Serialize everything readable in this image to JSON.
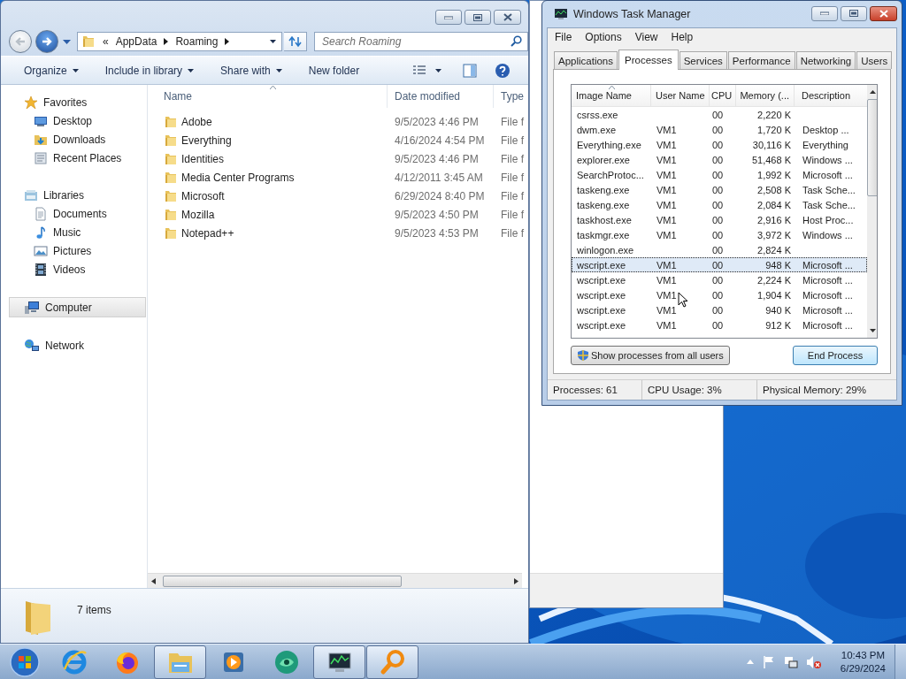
{
  "explorer": {
    "address": {
      "overflow_mark": "«",
      "path": [
        "AppData",
        "Roaming"
      ]
    },
    "search": {
      "placeholder": "Search Roaming"
    },
    "toolbar": [
      {
        "label": "Organize",
        "menu": true
      },
      {
        "label": "Include in library",
        "menu": true
      },
      {
        "label": "Share with",
        "menu": true
      },
      {
        "label": "New folder",
        "menu": false
      }
    ],
    "nav": [
      {
        "label": "Favorites",
        "kind": "favorites",
        "selected": false,
        "children": [
          {
            "label": "Desktop",
            "kind": "desktop",
            "selected": false
          },
          {
            "label": "Downloads",
            "kind": "downloads",
            "selected": false
          },
          {
            "label": "Recent Places",
            "kind": "recent",
            "selected": false
          }
        ]
      },
      {
        "label": "Libraries",
        "kind": "libraries",
        "selected": false,
        "children": [
          {
            "label": "Documents",
            "kind": "documents",
            "selected": false
          },
          {
            "label": "Music",
            "kind": "music",
            "selected": false
          },
          {
            "label": "Pictures",
            "kind": "pictures",
            "selected": false
          },
          {
            "label": "Videos",
            "kind": "videos",
            "selected": false
          }
        ]
      },
      {
        "label": "Computer",
        "kind": "computer",
        "selected": true
      },
      {
        "label": "Network",
        "kind": "network",
        "selected": false
      }
    ],
    "columns": [
      "Name",
      "Date modified",
      "Type"
    ],
    "files": [
      {
        "name": "Adobe",
        "date": "9/5/2023 4:46 PM",
        "type": "File f"
      },
      {
        "name": "Everything",
        "date": "4/16/2024 4:54 PM",
        "type": "File f"
      },
      {
        "name": "Identities",
        "date": "9/5/2023 4:46 PM",
        "type": "File f"
      },
      {
        "name": "Media Center Programs",
        "date": "4/12/2011 3:45 AM",
        "type": "File f"
      },
      {
        "name": "Microsoft",
        "date": "6/29/2024 8:40 PM",
        "type": "File f"
      },
      {
        "name": "Mozilla",
        "date": "9/5/2023 4:50 PM",
        "type": "File f"
      },
      {
        "name": "Notepad++",
        "date": "9/5/2023 4:53 PM",
        "type": "File f"
      }
    ],
    "status": "7 items"
  },
  "task_manager": {
    "title": "Windows Task Manager",
    "menu": [
      "File",
      "Options",
      "View",
      "Help"
    ],
    "tabs": [
      {
        "label": "Applications",
        "selected": false
      },
      {
        "label": "Processes",
        "selected": true
      },
      {
        "label": "Services",
        "selected": false
      },
      {
        "label": "Performance",
        "selected": false
      },
      {
        "label": "Networking",
        "selected": false
      },
      {
        "label": "Users",
        "selected": false
      }
    ],
    "columns": [
      "Image Name",
      "User Name",
      "CPU",
      "Memory (...",
      "Description"
    ],
    "rows": [
      {
        "image": "csrss.exe",
        "user": "",
        "cpu": "00",
        "memory": "2,220 K",
        "description": "",
        "selected": false
      },
      {
        "image": "dwm.exe",
        "user": "VM1",
        "cpu": "00",
        "memory": "1,720 K",
        "description": "Desktop ...",
        "selected": false
      },
      {
        "image": "Everything.exe",
        "user": "VM1",
        "cpu": "00",
        "memory": "30,116 K",
        "description": "Everything",
        "selected": false
      },
      {
        "image": "explorer.exe",
        "user": "VM1",
        "cpu": "00",
        "memory": "51,468 K",
        "description": "Windows ...",
        "selected": false
      },
      {
        "image": "SearchProtoc...",
        "user": "VM1",
        "cpu": "00",
        "memory": "1,992 K",
        "description": "Microsoft ...",
        "selected": false
      },
      {
        "image": "taskeng.exe",
        "user": "VM1",
        "cpu": "00",
        "memory": "2,508 K",
        "description": "Task Sche...",
        "selected": false
      },
      {
        "image": "taskeng.exe",
        "user": "VM1",
        "cpu": "00",
        "memory": "2,084 K",
        "description": "Task Sche...",
        "selected": false
      },
      {
        "image": "taskhost.exe",
        "user": "VM1",
        "cpu": "00",
        "memory": "2,916 K",
        "description": "Host Proc...",
        "selected": false
      },
      {
        "image": "taskmgr.exe",
        "user": "VM1",
        "cpu": "00",
        "memory": "3,972 K",
        "description": "Windows ...",
        "selected": false
      },
      {
        "image": "winlogon.exe",
        "user": "",
        "cpu": "00",
        "memory": "2,824 K",
        "description": "",
        "selected": false
      },
      {
        "image": "wscript.exe",
        "user": "VM1",
        "cpu": "00",
        "memory": "948 K",
        "description": "Microsoft ...",
        "selected": true
      },
      {
        "image": "wscript.exe",
        "user": "VM1",
        "cpu": "00",
        "memory": "2,224 K",
        "description": "Microsoft ...",
        "selected": false
      },
      {
        "image": "wscript.exe",
        "user": "VM1",
        "cpu": "00",
        "memory": "1,904 K",
        "description": "Microsoft ...",
        "selected": false
      },
      {
        "image": "wscript.exe",
        "user": "VM1",
        "cpu": "00",
        "memory": "940 K",
        "description": "Microsoft ...",
        "selected": false
      },
      {
        "image": "wscript.exe",
        "user": "VM1",
        "cpu": "00",
        "memory": "912 K",
        "description": "Microsoft ...",
        "selected": false
      }
    ],
    "show_all_button": "Show processes from all users",
    "end_button": "End Process",
    "status": [
      "Processes: 61",
      "CPU Usage: 3%",
      "Physical Memory: 29%"
    ]
  },
  "taskbar": {
    "apps": [
      {
        "kind": "ie",
        "running": false
      },
      {
        "kind": "firefox",
        "running": false
      },
      {
        "kind": "explorer",
        "running": true
      },
      {
        "kind": "media",
        "running": false
      },
      {
        "kind": "green",
        "running": false
      },
      {
        "kind": "taskmgr",
        "running": true
      },
      {
        "kind": "search",
        "running": true
      }
    ],
    "time": "10:43 PM",
    "date": "6/29/2024"
  }
}
